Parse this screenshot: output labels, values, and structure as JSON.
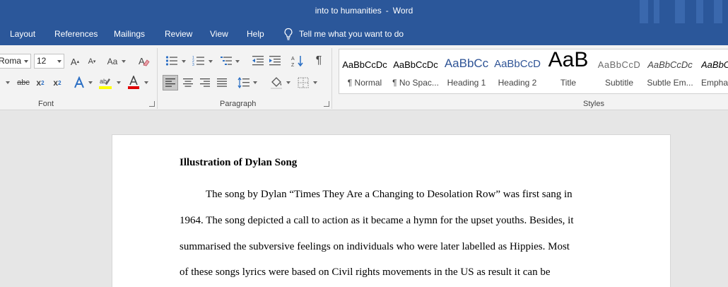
{
  "window": {
    "doc_title": "into to humanities",
    "separator": "-",
    "app_name": "Word"
  },
  "menu": {
    "items": [
      {
        "label": "Layout",
        "name": "menu-layout"
      },
      {
        "label": "References",
        "name": "menu-references"
      },
      {
        "label": "Mailings",
        "name": "menu-mailings"
      },
      {
        "label": "Review",
        "name": "menu-review"
      },
      {
        "label": "View",
        "name": "menu-view"
      },
      {
        "label": "Help",
        "name": "menu-help"
      }
    ],
    "tell_me": "Tell me what you want to do"
  },
  "ribbon": {
    "font": {
      "label": "Font",
      "family": "Roma",
      "size": "12",
      "grow_icon": "A",
      "shrink_icon": "A",
      "case_icon": "Aa",
      "strikethrough_icon": "abc",
      "subscript_icon": "x",
      "subscript_sub": "2",
      "superscript_icon": "x",
      "superscript_sup": "2",
      "highlight_color": "#ffff00",
      "font_color": "#e00000"
    },
    "paragraph": {
      "label": "Paragraph",
      "pilcrow": "¶"
    },
    "styles": {
      "label": "Styles",
      "items": [
        {
          "sample": "AaBbCcDc",
          "name": "¶ Normal"
        },
        {
          "sample": "AaBbCcDc",
          "name": "¶ No Spac..."
        },
        {
          "sample": "AaBbCc",
          "name": "Heading 1"
        },
        {
          "sample": "AaBbCcD",
          "name": "Heading 2"
        },
        {
          "sample": "AaB",
          "name": "Title"
        },
        {
          "sample": "AaBbCcD",
          "name": "Subtitle"
        },
        {
          "sample": "AaBbCcDc",
          "name": "Subtle Em..."
        },
        {
          "sample": "AaBbCcDc",
          "name": "Empha"
        }
      ]
    }
  },
  "document": {
    "heading": "Illustration of Dylan Song",
    "lines": [
      "The song by Dylan “Times They Are a Changing to Desolation Row” was first sang in",
      "1964. The song depicted a call to action as it became a hymn for the upset youths. Besides, it",
      "summarised the subversive feelings on individuals who were later labelled as Hippies. Most",
      "of these songs lyrics were based on Civil rights movements in the US as result it can be"
    ]
  },
  "colors": {
    "title_bar": "#2b579a",
    "ribbon": "#f3f3f3",
    "canvas": "#e6e6e6"
  }
}
